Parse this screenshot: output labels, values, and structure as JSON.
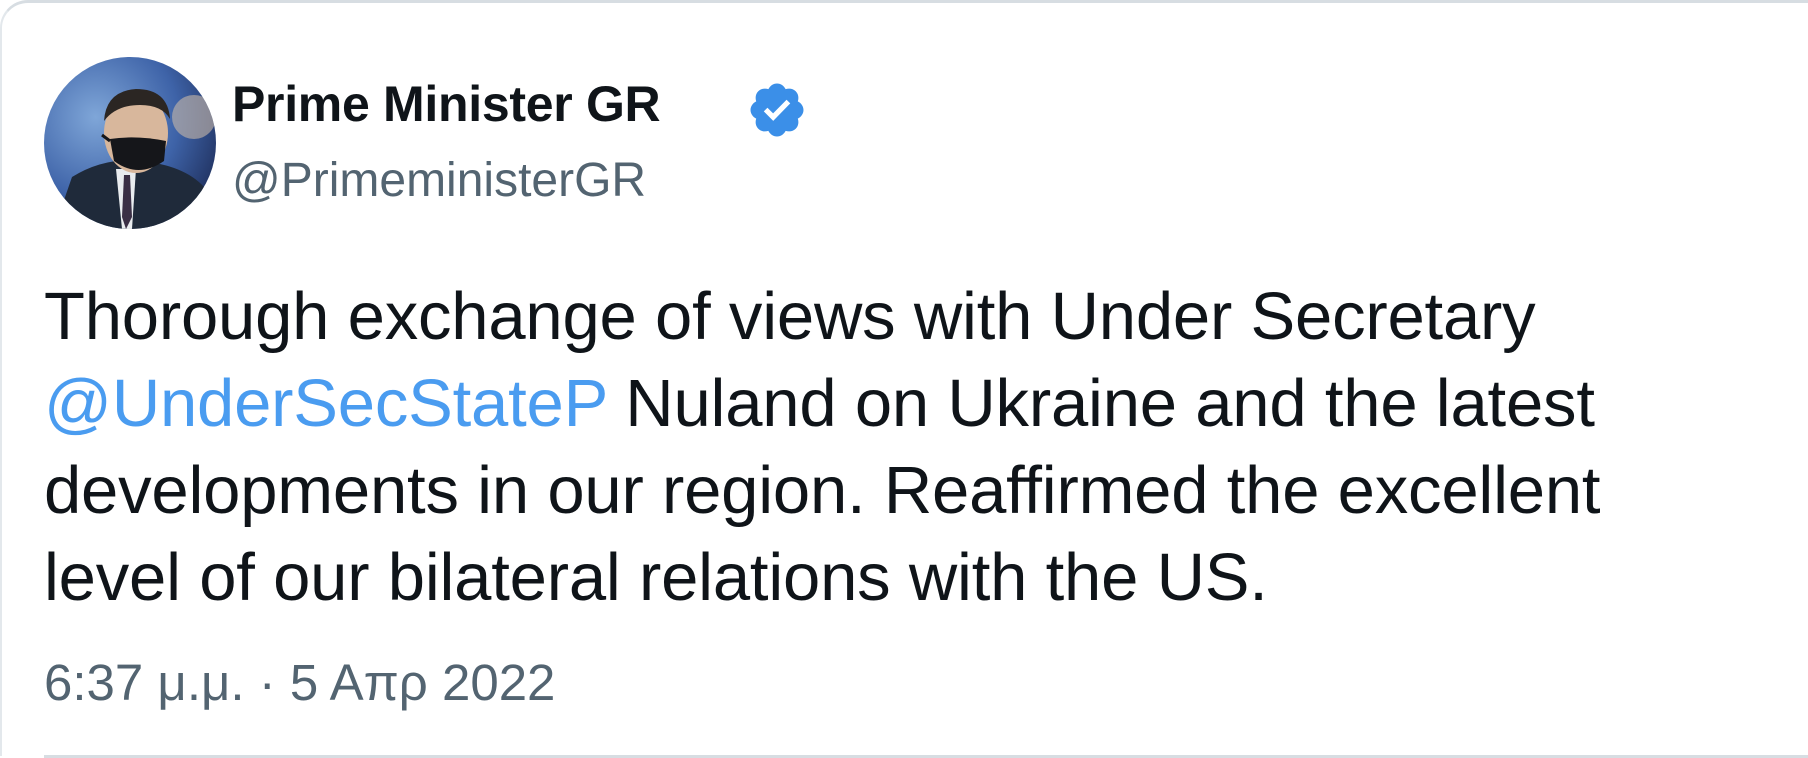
{
  "tweet": {
    "author": {
      "display_name": "Prime Minister GR",
      "handle": "@PrimeministerGR",
      "verified": true,
      "verified_icon": "verified-badge-icon"
    },
    "text_lines": [
      {
        "before": "Thorough exchange of views with Under Secretary",
        "mention": "",
        "after": ""
      },
      {
        "before": "",
        "mention": "@UnderSecStateP",
        "after": " Nuland on Ukraine and the latest"
      },
      {
        "before": "developments in our region. Reaffirmed the excellent",
        "mention": "",
        "after": ""
      },
      {
        "before": "level of our bilateral relations with the US.",
        "mention": "",
        "after": ""
      }
    ],
    "timestamp": "6:37 μ.μ. · 5 Απρ 2022"
  },
  "colors": {
    "text": "#0f1419",
    "secondary": "#536471",
    "mention": "#4a9cf0",
    "verified": "#3b8fe8",
    "border": "#d7dde2"
  }
}
